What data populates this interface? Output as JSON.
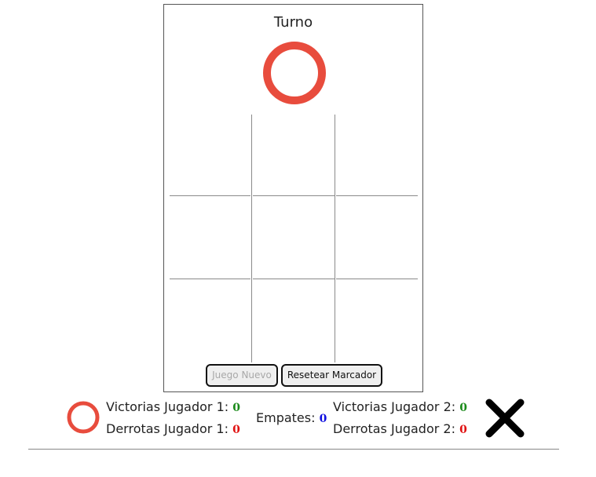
{
  "turn": {
    "title": "Turno",
    "current_symbol_icon": "o-ring-icon",
    "o_color": "#e84c3d"
  },
  "buttons": {
    "new_game": "Juego Nuevo",
    "reset_score": "Resetear Marcador"
  },
  "score": {
    "player1": {
      "icon": "o-ring-icon",
      "wins_label": "Victorias Jugador 1:",
      "wins": "0",
      "losses_label": "Derrotas Jugador 1:",
      "losses": "0"
    },
    "draws": {
      "label": "Empates:",
      "value": "0"
    },
    "player2": {
      "icon": "x-cross-icon",
      "wins_label": "Victorias Jugador 2:",
      "wins": "0",
      "losses_label": "Derrotas Jugador 2:",
      "losses": "0"
    }
  }
}
